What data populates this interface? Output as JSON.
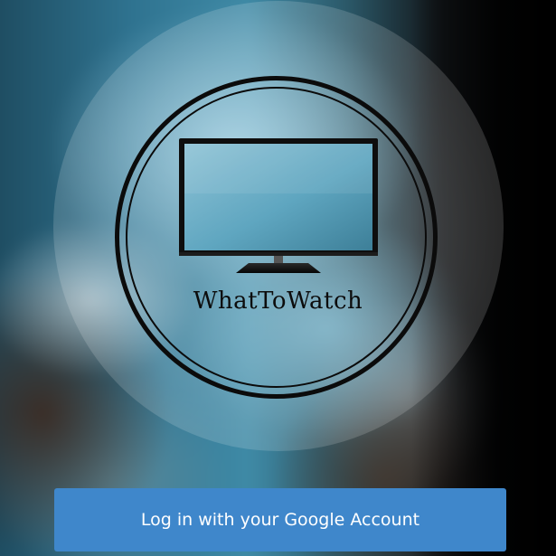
{
  "app": {
    "name": "WhatToWatch",
    "logo_icon": "tv-icon"
  },
  "login": {
    "button_label": "Log in with your Google Account"
  },
  "colors": {
    "button": "#3f87cb",
    "button_text": "#ffffff",
    "logo_ink": "#0b0b0b"
  }
}
